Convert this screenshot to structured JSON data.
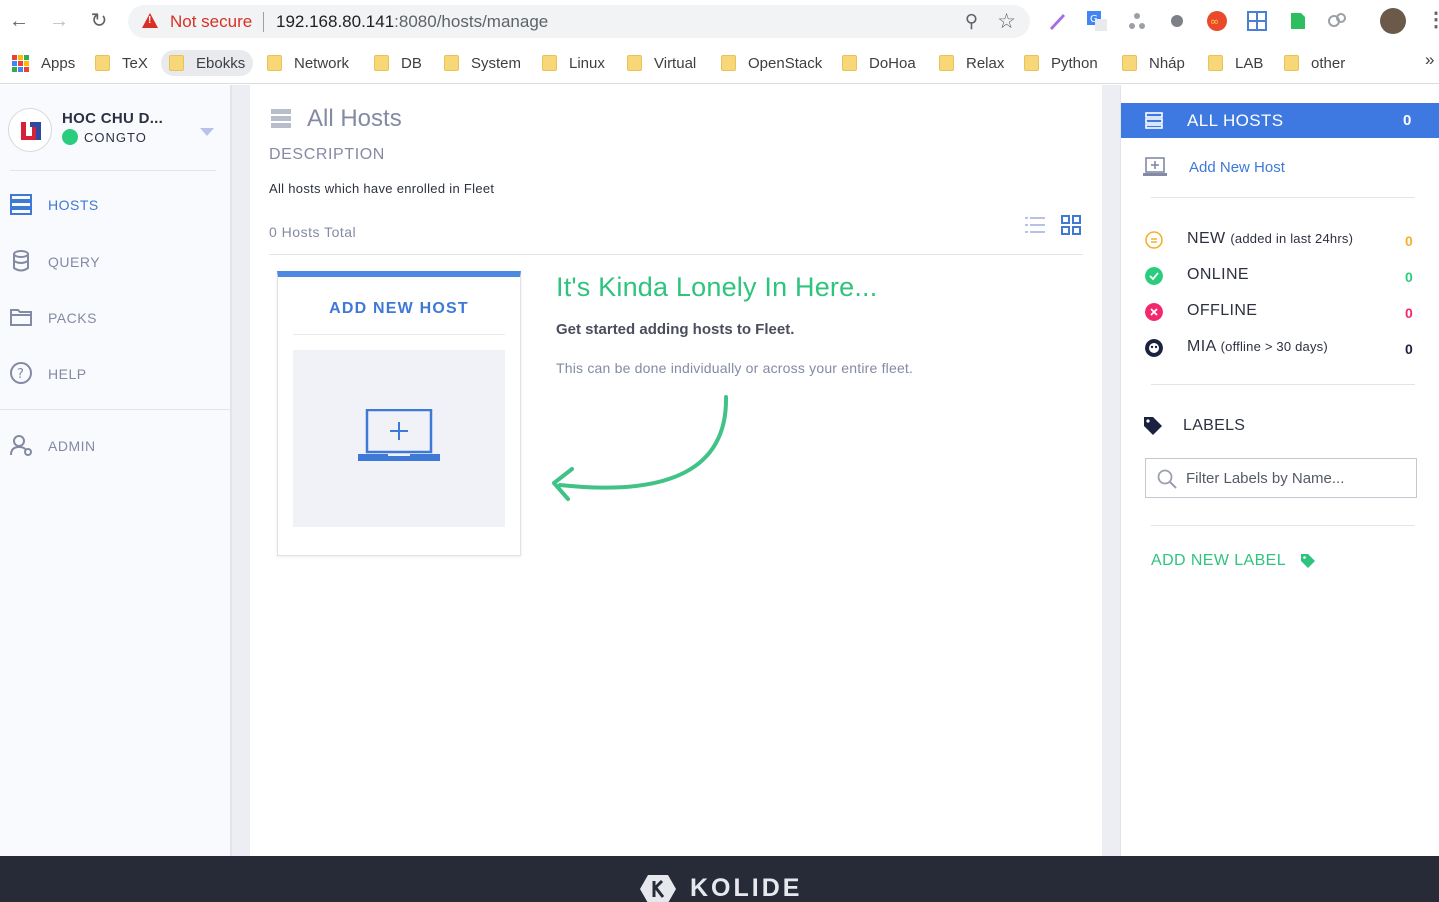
{
  "browser": {
    "security_label": "Not secure",
    "url_host": "192.168.80.141",
    "url_path": ":8080/hosts/manage"
  },
  "bookmarks": {
    "items": [
      "Apps",
      "TeX",
      "Ebokks",
      "Network",
      "DB",
      "System",
      "Linux",
      "Virtual",
      "OpenStack",
      "DoHoa",
      "Relax",
      "Python",
      "Nháp",
      "LAB",
      "other"
    ],
    "more": "»"
  },
  "sidebar": {
    "org_name": "HOC CHU D...",
    "user_name": "CONGTO",
    "nav": {
      "hosts": "HOSTS",
      "query": "QUERY",
      "packs": "PACKS",
      "help": "HELP",
      "admin": "ADMIN"
    }
  },
  "main": {
    "title": "All Hosts",
    "description_label": "DESCRIPTION",
    "description": "All hosts which have enrolled in Fleet",
    "hosts_total": "0 Hosts Total",
    "add_card_title": "ADD NEW HOST",
    "empty": {
      "title": "It's Kinda Lonely In Here...",
      "subtitle": "Get started adding hosts to Fleet.",
      "text": "This can be done individually or across your entire fleet."
    }
  },
  "panel": {
    "all_hosts_label": "ALL HOSTS",
    "all_hosts_count": "0",
    "add_host": "Add New Host",
    "statuses": {
      "new": {
        "name": "NEW",
        "note": "(added in last 24hrs)",
        "count": "0",
        "color": "#f5b02a"
      },
      "online": {
        "name": "ONLINE",
        "note": "",
        "count": "0",
        "color": "#2acc7e"
      },
      "offline": {
        "name": "OFFLINE",
        "note": "",
        "count": "0",
        "color": "#f2296e"
      },
      "mia": {
        "name": "MIA",
        "note": "(offline > 30 days)",
        "count": "0",
        "color": "#1b2240"
      }
    },
    "labels_heading": "LABELS",
    "filter_placeholder": "Filter Labels by Name...",
    "add_label": "ADD NEW LABEL"
  },
  "footer": {
    "brand": "KOLIDE"
  },
  "colors": {
    "accent_blue": "#3e79e2",
    "green": "#2ec47e",
    "muted": "#848aa3"
  }
}
